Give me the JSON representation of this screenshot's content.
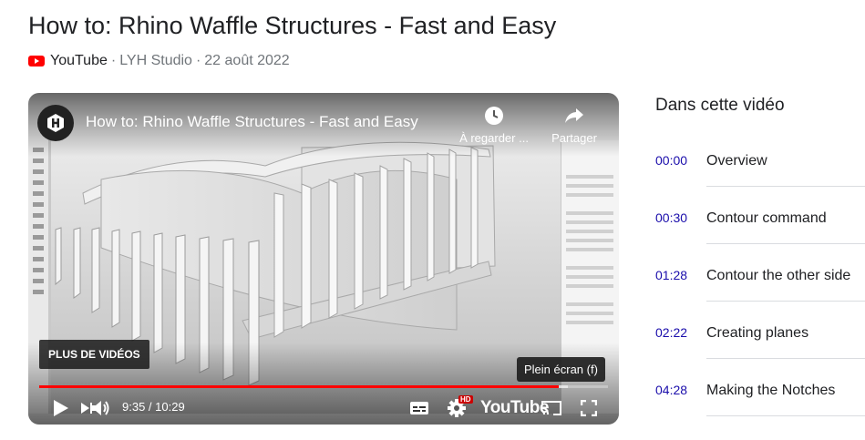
{
  "page": {
    "title": "How to: Rhino Waffle Structures - Fast and Easy",
    "source": "YouTube",
    "channel": "LYH Studio",
    "date": "22 août 2022",
    "separator": "·"
  },
  "player": {
    "video_title": "How to: Rhino Waffle Structures - Fast and Easy",
    "watch_later_label": "À regarder ...",
    "share_label": "Partager",
    "more_videos_label": "PLUS DE VIDÉOS",
    "fullscreen_tooltip": "Plein écran (f)",
    "current_time": "9:35",
    "duration": "10:29",
    "time_display": "9:35 / 10:29",
    "progress": 0.914,
    "buffered": 0.93,
    "youtube_wordmark": "YouTube",
    "hd_badge": "HD",
    "colors": {
      "progress": "#ff0000",
      "hd": "#cc0000"
    },
    "icons": {
      "channel": "channel-logo-icon",
      "watch_later": "clock-icon",
      "share": "share-arrow-icon",
      "play": "play-icon",
      "next": "next-icon",
      "volume": "volume-icon",
      "captions": "captions-icon",
      "settings": "gear-icon",
      "cast": "cast-icon",
      "fullscreen": "fullscreen-icon"
    }
  },
  "chapters": {
    "heading": "Dans cette vidéo",
    "items": [
      {
        "time": "00:00",
        "label": "Overview"
      },
      {
        "time": "00:30",
        "label": "Contour command"
      },
      {
        "time": "01:28",
        "label": "Contour the other side"
      },
      {
        "time": "02:22",
        "label": "Creating planes"
      },
      {
        "time": "04:28",
        "label": "Making the Notches"
      }
    ]
  }
}
